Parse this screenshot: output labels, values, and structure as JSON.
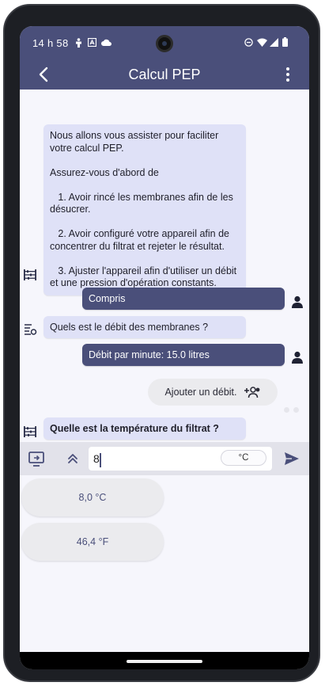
{
  "status_bar": {
    "time": "14 h 58"
  },
  "app_bar": {
    "title": "Calcul PEP"
  },
  "chat": {
    "intro_lines": [
      "Nous allons vous assister pour faciliter",
      "votre calcul PEP.",
      "",
      "Assurez-vous d'abord de",
      "",
      "   1. Avoir rincé les membranes afin de les",
      "désucrer.",
      "",
      "   2. Avoir configuré votre appareil afin de",
      "concentrer du filtrat et rejeter le résultat.",
      "",
      "   3. Ajuster l'appareil afin d'utiliser un débit",
      "et une pression d'opération constants."
    ],
    "reply_1": "Compris",
    "question_1": "Quels est le débit des membranes ?",
    "reply_2": "Débit par minute: 15.0 litres",
    "suggestion": "Ajouter un débit.",
    "question_2": "Quelle est la température du filtrat ?"
  },
  "input": {
    "value": "8",
    "unit": "°C"
  },
  "options": [
    {
      "label": "8,0 °C"
    },
    {
      "label": "46,4 °F"
    }
  ],
  "colors": {
    "primary": "#4a4f7a",
    "bot_bubble": "#dfe1f7",
    "background": "#f6f6fc"
  }
}
